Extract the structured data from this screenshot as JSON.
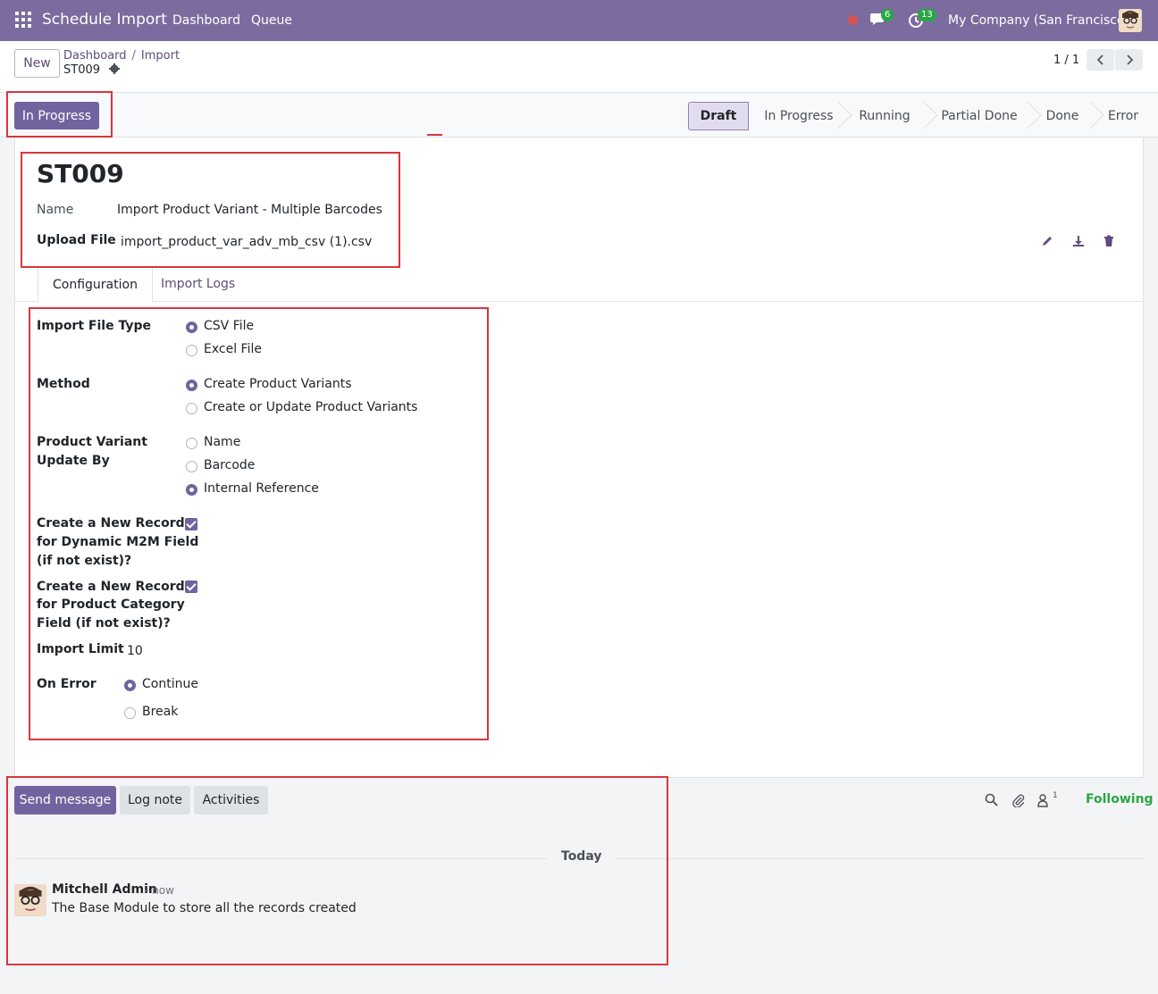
{
  "navbar": {
    "app_title": "Schedule Import",
    "links": [
      "Dashboard",
      "Queue"
    ],
    "messages_count": "6",
    "activities_count": "13",
    "company": "My Company (San Francisco)"
  },
  "control_panel": {
    "new_label": "New",
    "breadcrumb": [
      "Dashboard",
      "Import"
    ],
    "breadcrumb_sep": "/",
    "record": "ST009",
    "pager": "1 / 1"
  },
  "statusbar": {
    "action_button": "In Progress",
    "stages": [
      "Draft",
      "In Progress",
      "Running",
      "Partial Done",
      "Done",
      "Error"
    ],
    "active_stage": "Draft"
  },
  "form": {
    "title": "ST009",
    "name_label": "Name",
    "name_value": "Import Product Variant - Multiple Barcodes",
    "upload_label": "Upload File",
    "upload_value": "import_product_var_adv_mb_csv (1).csv",
    "tabs": [
      "Configuration",
      "Import Logs"
    ],
    "config": {
      "file_type_label": "Import File Type",
      "file_type_options": [
        "CSV File",
        "Excel File"
      ],
      "file_type_selected": "CSV File",
      "method_label": "Method",
      "method_options": [
        "Create Product Variants",
        "Create or Update Product Variants"
      ],
      "method_selected": "Create Product Variants",
      "update_by_label_1": "Product Variant",
      "update_by_label_2": "Update By",
      "update_by_options": [
        "Name",
        "Barcode",
        "Internal Reference"
      ],
      "update_by_selected": "Internal Reference",
      "m2m_label_1": "Create a New Record",
      "m2m_label_2": "for Dynamic M2M Field",
      "m2m_label_3": "(if not exist)?",
      "m2m_checked": true,
      "categ_label_1": "Create a New Record",
      "categ_label_2": "for Product Category",
      "categ_label_3": "Field (if not exist)?",
      "categ_checked": true,
      "limit_label": "Import Limit",
      "limit_value": "10",
      "on_error_label": "On Error",
      "on_error_options": [
        "Continue",
        "Break"
      ],
      "on_error_selected": "Continue"
    }
  },
  "chatter": {
    "send_label": "Send message",
    "log_label": "Log note",
    "activities_label": "Activities",
    "followers_count": "1",
    "following_label": "Following",
    "date_separator": "Today",
    "message": {
      "author": "Mitchell Admin",
      "time": "- now",
      "body": "The Base Module to store all the records created"
    }
  },
  "colors": {
    "brand": "#7c6b9e",
    "primary": "#71639e",
    "success": "#28a745",
    "annotation": "#d9363e"
  }
}
